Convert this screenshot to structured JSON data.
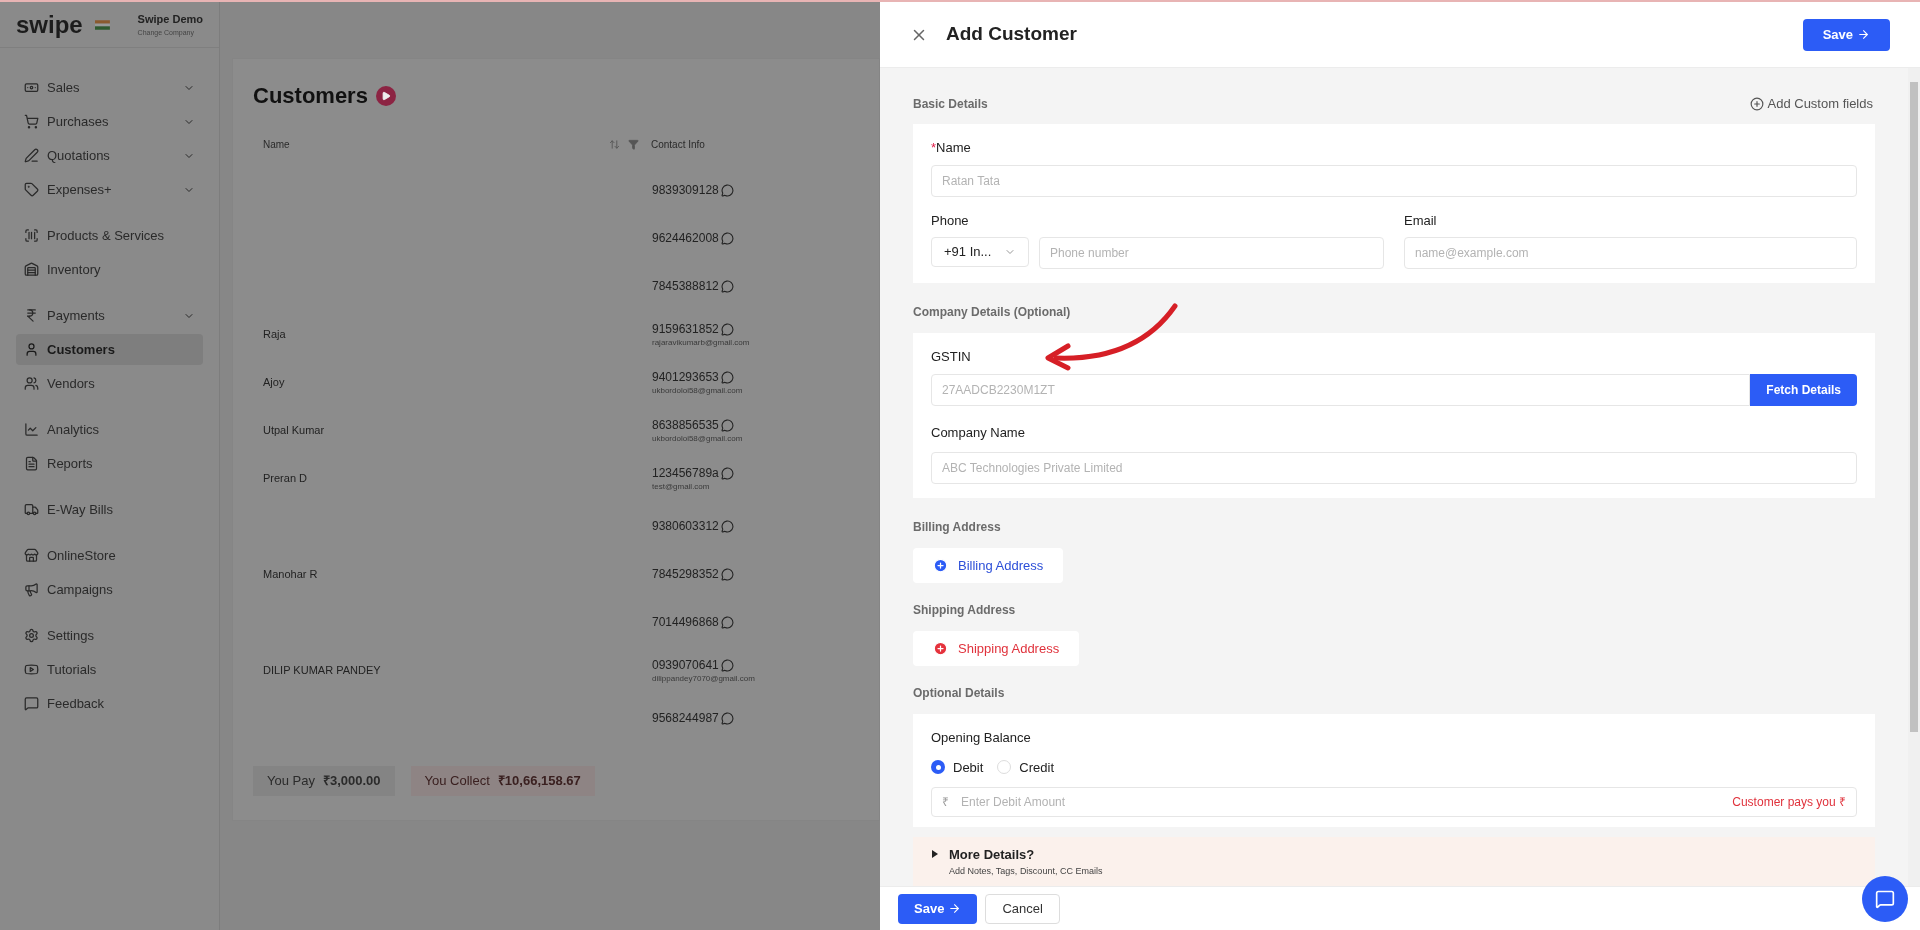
{
  "app": {
    "logo": "swipe",
    "company": "Swipe Demo",
    "company_link": "Change Company"
  },
  "sidebar": {
    "groups": [
      [
        {
          "label": "Sales",
          "expandable": true,
          "selected": false
        },
        {
          "label": "Purchases",
          "expandable": true,
          "selected": false
        },
        {
          "label": "Quotations",
          "expandable": true,
          "selected": false
        },
        {
          "label": "Expenses+",
          "expandable": true,
          "selected": false
        }
      ],
      [
        {
          "label": "Products & Services",
          "expandable": false,
          "selected": false
        },
        {
          "label": "Inventory",
          "expandable": false,
          "selected": false
        }
      ],
      [
        {
          "label": "Payments",
          "expandable": true,
          "selected": false
        },
        {
          "label": "Customers",
          "expandable": false,
          "selected": true
        },
        {
          "label": "Vendors",
          "expandable": false,
          "selected": false
        }
      ],
      [
        {
          "label": "Analytics",
          "expandable": false,
          "selected": false
        },
        {
          "label": "Reports",
          "expandable": false,
          "selected": false
        }
      ],
      [
        {
          "label": "E-Way Bills",
          "expandable": false,
          "selected": false
        }
      ],
      [
        {
          "label": "OnlineStore",
          "expandable": false,
          "selected": false
        },
        {
          "label": "Campaigns",
          "expandable": false,
          "selected": false
        }
      ],
      [
        {
          "label": "Settings",
          "expandable": false,
          "selected": false
        },
        {
          "label": "Tutorials",
          "expandable": false,
          "selected": false
        },
        {
          "label": "Feedback",
          "expandable": false,
          "selected": false
        }
      ]
    ]
  },
  "page": {
    "title": "Customers",
    "columns": [
      "Name",
      "Contact Info"
    ],
    "rows": [
      {
        "phone": "9839309128"
      },
      {
        "phone": "9624462008"
      },
      {
        "phone": "7845388812"
      },
      {
        "name": "Raja",
        "phone": "9159631852",
        "email": "rajaravikumarb@gmail.com"
      },
      {
        "name": "Ajoy",
        "phone": "9401293653",
        "email": "ukbordoloi58@gmail.com"
      },
      {
        "name": "Utpal Kumar",
        "phone": "8638856535",
        "email": "ukbordoloi58@gmail.com"
      },
      {
        "name": "Preran D",
        "phone": "123456789a",
        "email": "test@gmail.com"
      },
      {
        "phone": "9380603312"
      },
      {
        "name": "Manohar R",
        "phone": "7845298352"
      },
      {
        "phone": "7014496868"
      },
      {
        "name": "DILIP KUMAR PANDEY",
        "phone": "0939070641",
        "email": "dilippandey7070@gmail.com"
      },
      {
        "phone": "9568244987"
      }
    ],
    "summary": [
      {
        "kind": "pay",
        "label": "You Pay",
        "amount": "₹3,000.00"
      },
      {
        "kind": "collect",
        "label": "You Collect",
        "amount": "₹10,66,158.67"
      }
    ]
  },
  "drawer": {
    "title": "Add Customer",
    "save": "Save",
    "basic": {
      "heading": "Basic Details",
      "custom_fields": "Add Custom fields",
      "required_mark": "*",
      "name_label": "Name",
      "name_placeholder": "Ratan Tata",
      "phone_label": "Phone",
      "country_code": "+91 In...",
      "phone_placeholder": "Phone number",
      "email_label": "Email",
      "email_placeholder": "name@example.com"
    },
    "company": {
      "heading": "Company Details (Optional)",
      "gstin_label": "GSTIN",
      "gstin_placeholder": "27AADCB2230M1ZT",
      "fetch": "Fetch Details",
      "company_label": "Company Name",
      "company_placeholder": "ABC Technologies Private Limited"
    },
    "billing": {
      "heading": "Billing Address",
      "button": "Billing Address"
    },
    "shipping": {
      "heading": "Shipping Address",
      "button": "Shipping Address"
    },
    "optional": {
      "heading": "Optional Details",
      "balance_label": "Opening Balance",
      "options": [
        {
          "label": "Debit",
          "selected": true
        },
        {
          "label": "Credit",
          "selected": false
        }
      ],
      "currency": "₹",
      "amount_placeholder": "Enter Debit Amount",
      "amount_hint": "Customer pays you ₹"
    },
    "more": {
      "title": "More Details?",
      "subtitle": "Add Notes, Tags, Discount, CC Emails",
      "expanded": false
    },
    "footer": {
      "save": "Save",
      "cancel": "Cancel"
    }
  }
}
